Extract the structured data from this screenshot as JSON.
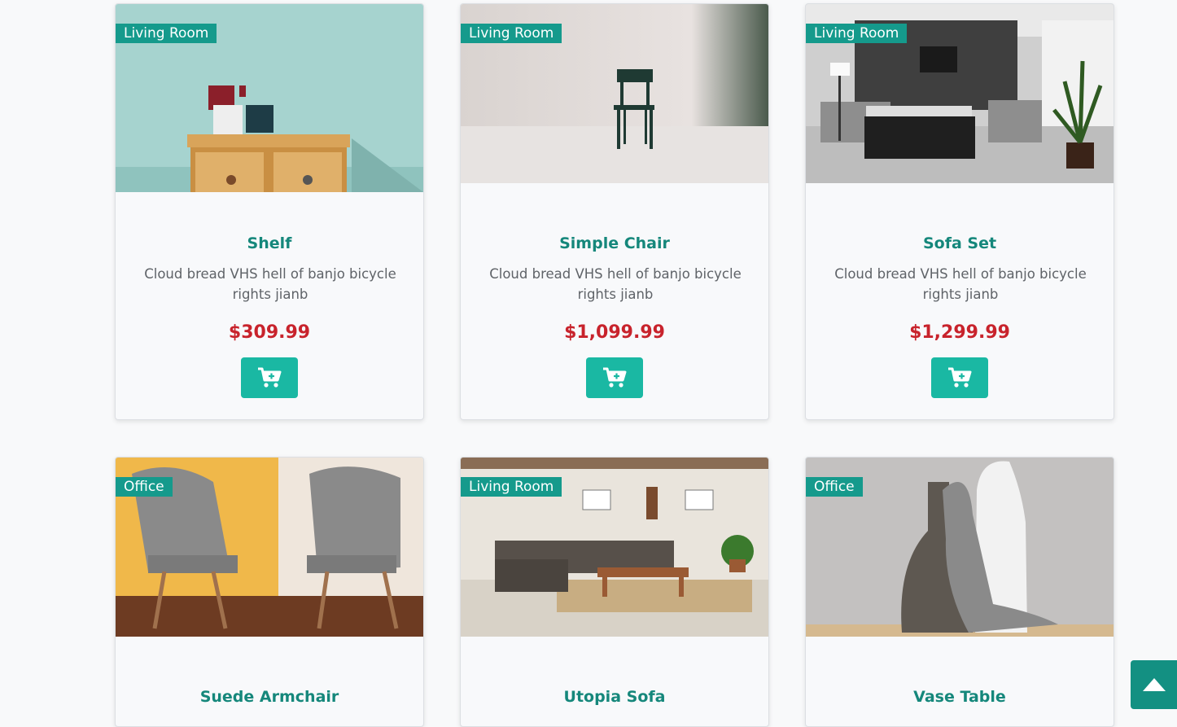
{
  "products": [
    {
      "category": "Living Room",
      "title": "Shelf",
      "description": "Cloud bread VHS hell of banjo bicycle rights jianb",
      "price": "$309.99",
      "cart_icon": "cart-plus-icon"
    },
    {
      "category": "Living Room",
      "title": "Simple Chair",
      "description": "Cloud bread VHS hell of banjo bicycle rights jianb",
      "price": "$1,099.99",
      "cart_icon": "cart-plus-icon"
    },
    {
      "category": "Living Room",
      "title": "Sofa Set",
      "description": "Cloud bread VHS hell of banjo bicycle rights jianb",
      "price": "$1,299.99",
      "cart_icon": "cart-plus-icon"
    },
    {
      "category": "Office",
      "title": "Suede Armchair"
    },
    {
      "category": "Living Room",
      "title": "Utopia Sofa"
    },
    {
      "category": "Office",
      "title": "Vase Table"
    }
  ],
  "scroll_top_icon": "caret-up-icon",
  "colors": {
    "accent": "#159a8c",
    "button": "#1ab8a3",
    "title": "#15877b",
    "price": "#c8232c"
  }
}
